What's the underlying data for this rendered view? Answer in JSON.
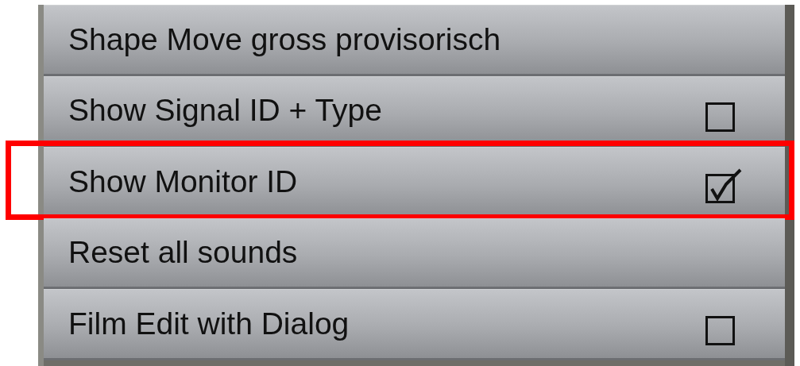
{
  "menu": {
    "items": [
      {
        "label": "Shape Move gross provisorisch",
        "kind": "action",
        "highlighted": false
      },
      {
        "label": "Show Signal ID + Type",
        "kind": "toggle",
        "checked": false,
        "highlighted": false
      },
      {
        "label": "Show Monitor ID",
        "kind": "toggle",
        "checked": true,
        "highlighted": true
      },
      {
        "label": "Reset all sounds",
        "kind": "action",
        "highlighted": false
      },
      {
        "label": "Film Edit with Dialog",
        "kind": "toggle",
        "checked": false,
        "highlighted": false
      }
    ]
  }
}
